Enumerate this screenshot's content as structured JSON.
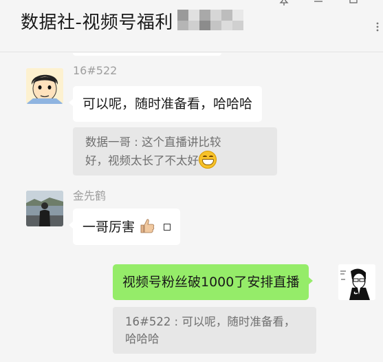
{
  "window": {
    "title": "数据社-视频号福利",
    "pin_icon": "pin-icon",
    "minimize_icon": "minimize-icon",
    "maximize_icon": "maximize-icon",
    "more_icon": "more-icon"
  },
  "messages": [
    {
      "sender": "16#522",
      "avatar": "cartoon-face-avatar",
      "text": "可以呢，随时准备看，哈哈哈",
      "quote": {
        "line1": "数据一哥 : 这个直播讲比较",
        "line2": "好，视频太长了不太好",
        "emoji": "grin-emoji"
      }
    },
    {
      "sender": "金先鹤",
      "avatar": "photo-avatar",
      "text": "一哥厉害",
      "emoji": "thumbs-up-emoji"
    },
    {
      "sender": "",
      "avatar": "self-avatar",
      "text": "视频号粉丝破1000了安排直播",
      "quote": {
        "line1": "16#522 : 可以呢，随时准备看，",
        "line2": "哈哈哈"
      }
    }
  ],
  "colors": {
    "background": "#f5f5f5",
    "bubble_white": "#ffffff",
    "bubble_green": "#95ec69",
    "quote_bg": "#e7e7e7"
  }
}
